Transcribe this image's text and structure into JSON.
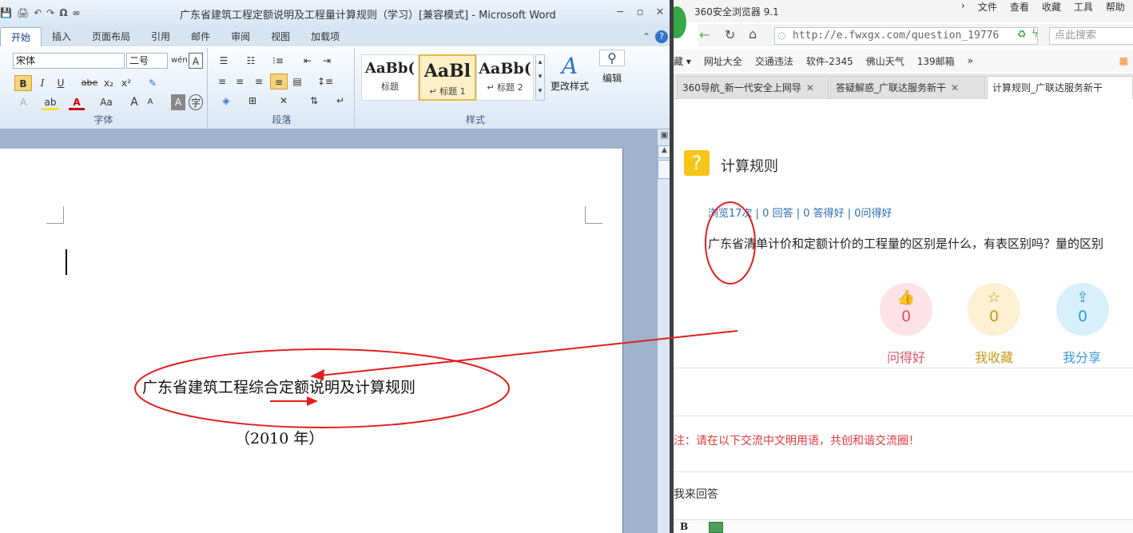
{
  "word": {
    "title": "广东省建筑工程定额说明及工程量计算规则（学习）[兼容模式] - Microsoft Word",
    "quick_access": [
      "💾",
      "🖨",
      "↶",
      "↷",
      "Ω",
      "∞"
    ],
    "window_controls": [
      "─",
      "▫",
      "✕"
    ],
    "tabs": [
      "开始",
      "插入",
      "页面布局",
      "引用",
      "邮件",
      "审阅",
      "视图",
      "加载项"
    ],
    "active_tab": "开始",
    "font": {
      "name": "宋体",
      "size": "二号",
      "group_label": "字体",
      "bold": "B",
      "italic": "I",
      "underline": "U",
      "strike": "abe",
      "sub": "x₂",
      "sup": "x²",
      "grow": "A",
      "shrink": "A",
      "case": "Aa",
      "char_border": "A",
      "phonetic": "wén",
      "color": "A"
    },
    "paragraph": {
      "group_label": "段落"
    },
    "styles": {
      "group_label": "样式",
      "items": [
        {
          "preview": "AaBb(",
          "name": "标题"
        },
        {
          "preview": "AaBl",
          "name": "↵ 标题 1"
        },
        {
          "preview": "AaBb(",
          "name": "↵ 标题 2"
        }
      ],
      "change_styles": "更改样式"
    },
    "edit": {
      "label": "编辑"
    },
    "document": {
      "heading": "广东省建筑工程综合定额说明及计算规则",
      "year": "（2010 年）"
    }
  },
  "browser": {
    "app_name": "360安全浏览器 9.1",
    "menu": [
      "文件",
      "查看",
      "收藏",
      "工具",
      "帮助"
    ],
    "url": "http://e.fwxgx.com/question_19776",
    "search_placeholder": "点此搜索",
    "bookmarks": [
      "藏 ▾",
      "网址大全",
      "交通违法",
      "软件-2345",
      "佛山天气",
      "139邮箱",
      "»"
    ],
    "tabs": [
      {
        "label": "360导航_新一代安全上网导",
        "active": false
      },
      {
        "label": "答疑解惑_广联达服务新干",
        "active": false
      },
      {
        "label": "计算规则_广联达服务新干",
        "active": true
      }
    ],
    "question": {
      "title": "计算规则",
      "stats": "浏览17次 | 0 回答 | 0 答得好 | 0问得好",
      "text": "广东省清单计价和定额计价的工程量的区别是什么，有表区别吗？量的区别"
    },
    "actions": [
      {
        "name": "问得好",
        "count": "0",
        "icon": "thumbs-up-icon",
        "color": "#e8506a",
        "bg": "#fde3e7"
      },
      {
        "name": "我收藏",
        "count": "0",
        "icon": "star-icon",
        "color": "#c99a1a",
        "bg": "#fdf0d3"
      },
      {
        "name": "我分享",
        "count": "0",
        "icon": "share-icon",
        "color": "#3a9ad9",
        "bg": "#d8f0fb"
      }
    ],
    "notice": "注：请在以下交流中文明用语，共创和谐交流圈！",
    "answer_label": "我来回答",
    "editor_bold": "B"
  }
}
